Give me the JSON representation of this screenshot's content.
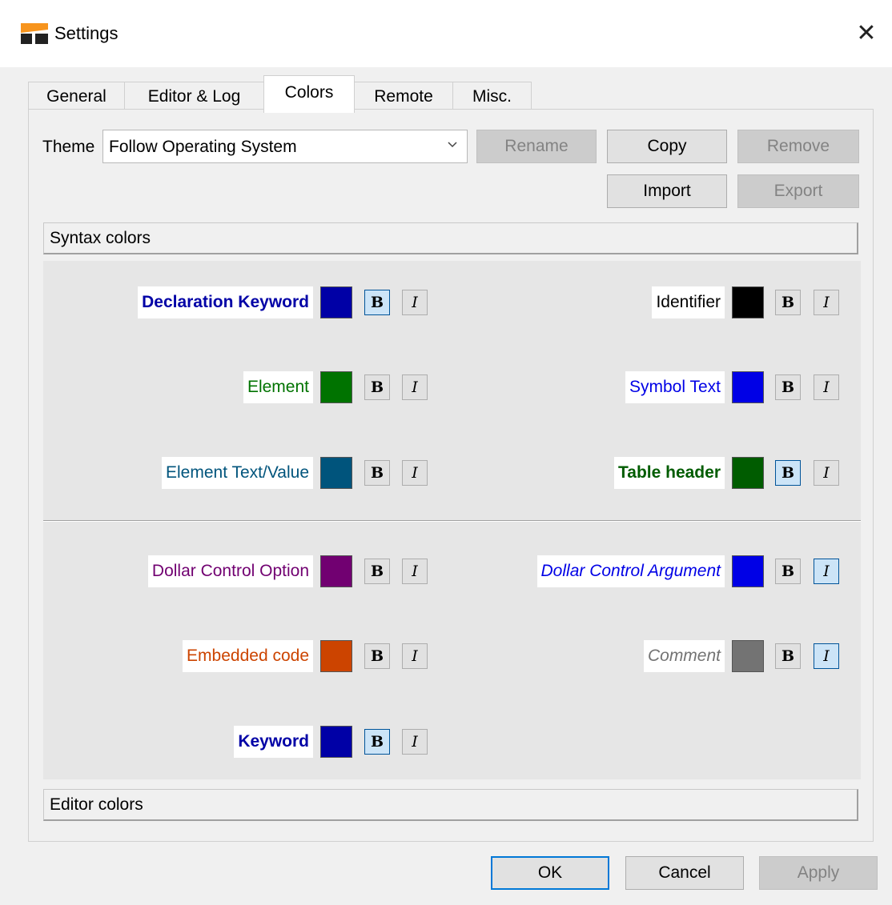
{
  "window": {
    "title": "Settings",
    "close_glyph": "✕"
  },
  "tabs": [
    {
      "label": "General",
      "active": false
    },
    {
      "label": "Editor & Log",
      "active": false
    },
    {
      "label": "Colors",
      "active": true
    },
    {
      "label": "Remote",
      "active": false
    },
    {
      "label": "Misc.",
      "active": false
    }
  ],
  "theme": {
    "label": "Theme",
    "value": "Follow Operating System",
    "rename": "Rename",
    "copy": "Copy",
    "remove": "Remove",
    "import": "Import",
    "export": "Export"
  },
  "sections": {
    "syntax": "Syntax colors",
    "editor": "Editor colors"
  },
  "syntax": [
    {
      "name": "Declaration Keyword",
      "color": "#0000a6",
      "bold": true,
      "italic": false
    },
    {
      "name": "Identifier",
      "color": "#000000",
      "bold": false,
      "italic": false
    },
    {
      "name": "Element",
      "color": "#007300",
      "bold": false,
      "italic": false
    },
    {
      "name": "Symbol Text",
      "color": "#0000e6",
      "bold": false,
      "italic": false
    },
    {
      "name": "Element Text/Value",
      "color": "#00547c",
      "bold": false,
      "italic": false
    },
    {
      "name": "Table header",
      "color": "#005c00",
      "bold": true,
      "italic": false
    },
    {
      "name": "Dollar Control Option",
      "color": "#710071",
      "bold": false,
      "italic": false
    },
    {
      "name": "Dollar Control Argument",
      "color": "#0000e6",
      "bold": false,
      "italic": true
    },
    {
      "name": "Embedded code",
      "color": "#cc4400",
      "bold": false,
      "italic": false
    },
    {
      "name": "Comment",
      "color": "#737373",
      "bold": false,
      "italic": true
    },
    {
      "name": "Keyword",
      "color": "#0000a6",
      "bold": true,
      "italic": false
    }
  ],
  "toggle_labels": {
    "bold": "B",
    "italic": "I"
  },
  "footer": {
    "ok": "OK",
    "cancel": "Cancel",
    "apply": "Apply"
  },
  "colors": {
    "accent": "#0078d7",
    "icon_orange": "#f7941d",
    "icon_dark": "#222222"
  }
}
